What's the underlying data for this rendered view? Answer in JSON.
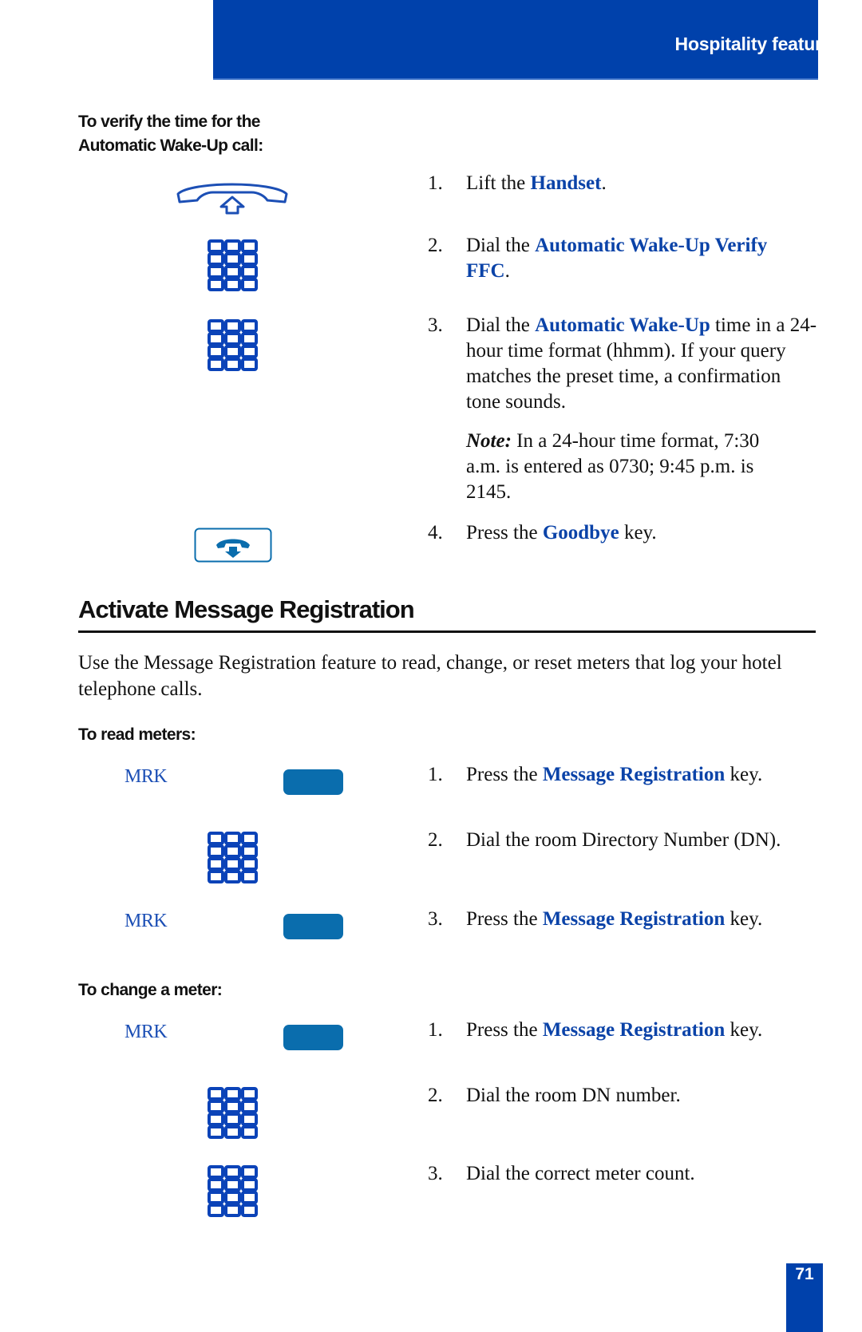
{
  "header": {
    "section_title": "Hospitality features"
  },
  "verify_section": {
    "subheading_line1": "To verify the time for the",
    "subheading_line2": "Automatic Wake-Up call:",
    "steps": [
      {
        "num": "1.",
        "pre": "Lift the ",
        "em": "Handset",
        "post": "."
      },
      {
        "num": "2.",
        "pre": "Dial the ",
        "em": "Automatic Wake-Up Verify FFC",
        "post": "."
      },
      {
        "num": "3.",
        "pre": "Dial the ",
        "em": "Automatic Wake-Up",
        "post": " time in a 24-hour time format (hhmm). If your query matches the preset time, a confirmation tone sounds."
      },
      {
        "num": "4.",
        "pre": "Press the ",
        "em": "Goodbye",
        "post": " key."
      }
    ],
    "note": {
      "label": "Note:",
      "text": " In a 24-hour time format, 7:30 a.m. is entered as 0730; 9:45 p.m. is 2145."
    },
    "icons": [
      "handset-lift-icon",
      "dialpad-icon",
      "dialpad-icon",
      "goodbye-key-icon"
    ]
  },
  "message_registration": {
    "title": "Activate Message Registration",
    "intro": "Use the Message Registration feature to read, change, or reset meters that log your hotel telephone calls.",
    "read_meters": {
      "subheading": "To read meters:",
      "key_label": "MRK",
      "steps": [
        {
          "num": "1.",
          "pre": "Press the ",
          "em": "Message Registration",
          "post": " key."
        },
        {
          "num": "2.",
          "pre": "Dial the room Directory Number (DN).",
          "em": "",
          "post": ""
        },
        {
          "num": "3.",
          "pre": "Press the ",
          "em": "Message Registration",
          "post": " key."
        }
      ]
    },
    "change_meter": {
      "subheading": "To change a meter:",
      "key_label": "MRK",
      "steps": [
        {
          "num": "1.",
          "pre": "Press the ",
          "em": "Message Registration",
          "post": " key."
        },
        {
          "num": "2.",
          "pre": "Dial the room DN number.",
          "em": "",
          "post": ""
        },
        {
          "num": "3.",
          "pre": "Dial the correct meter count.",
          "em": "",
          "post": ""
        }
      ]
    }
  },
  "footer": {
    "page_number": "71"
  },
  "colors": {
    "brand_blue": "#0041ab",
    "emphasis_blue": "#0b43a8",
    "softkey_blue": "#0a6dad"
  }
}
